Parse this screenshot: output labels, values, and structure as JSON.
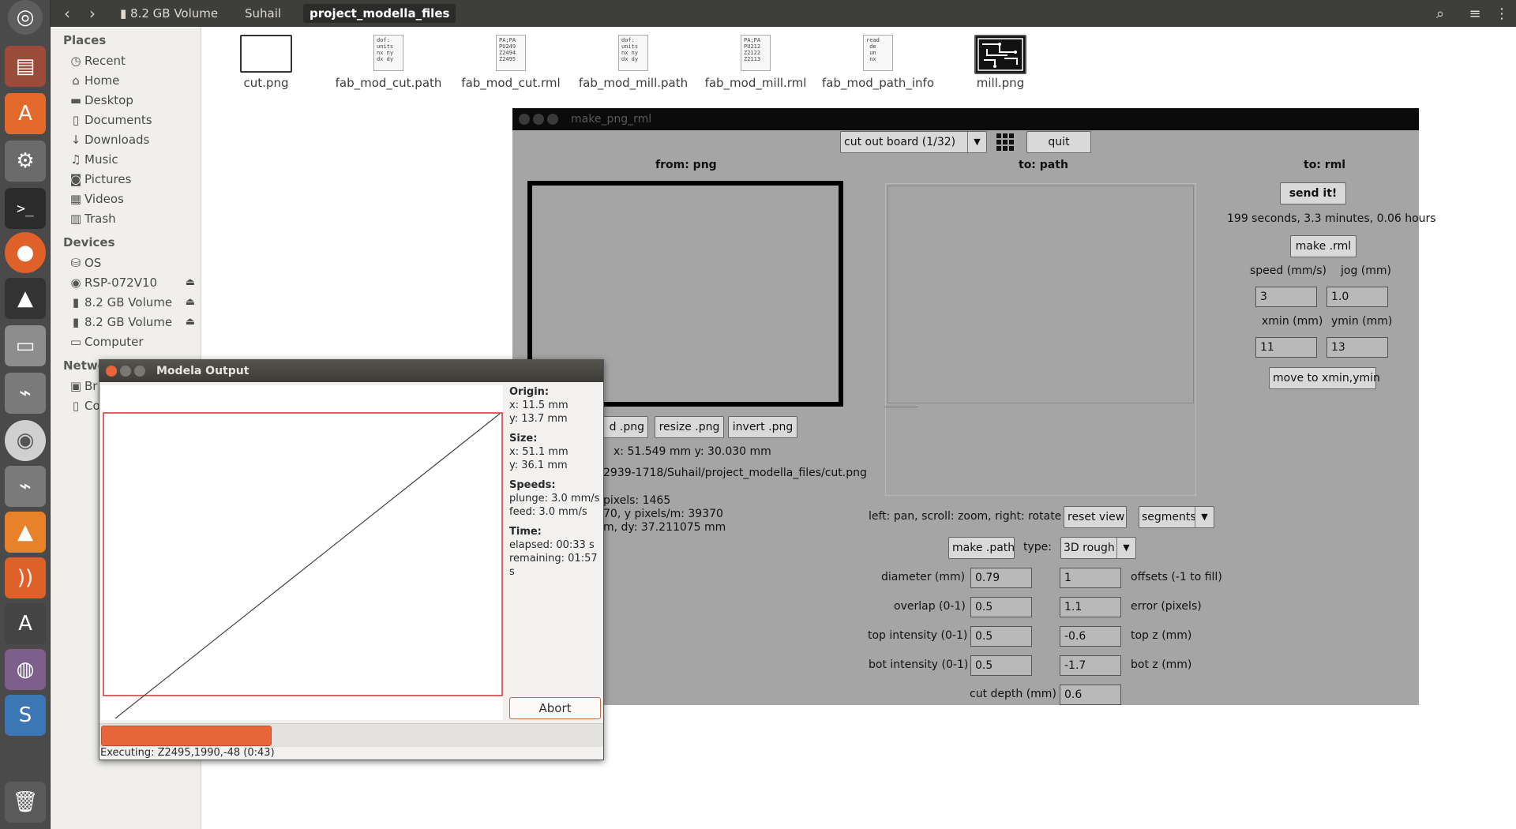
{
  "topbar": {
    "breadcrumbs": [
      "8.2 GB Volume",
      "Suhail",
      "project_modella_files"
    ]
  },
  "sidebar": {
    "places_title": "Places",
    "places": [
      {
        "label": "Recent",
        "icon": "clock-icon"
      },
      {
        "label": "Home",
        "icon": "home-icon"
      },
      {
        "label": "Desktop",
        "icon": "folder-icon"
      },
      {
        "label": "Documents",
        "icon": "document-icon"
      },
      {
        "label": "Downloads",
        "icon": "download-icon"
      },
      {
        "label": "Music",
        "icon": "music-icon"
      },
      {
        "label": "Pictures",
        "icon": "camera-icon"
      },
      {
        "label": "Videos",
        "icon": "video-icon"
      },
      {
        "label": "Trash",
        "icon": "trash-icon"
      }
    ],
    "devices_title": "Devices",
    "devices": [
      {
        "label": "OS",
        "icon": "drive-icon"
      },
      {
        "label": "RSP-072V10",
        "icon": "disc-icon"
      },
      {
        "label": "8.2 GB Volume",
        "icon": "usb-icon"
      },
      {
        "label": "8.2 GB Volume",
        "icon": "usb-icon"
      },
      {
        "label": "Computer",
        "icon": "computer-icon"
      }
    ],
    "network_title": "Netwo",
    "network": [
      {
        "label": "Br",
        "icon": "network-icon"
      },
      {
        "label": "Co",
        "icon": "server-icon"
      }
    ]
  },
  "files": [
    {
      "name": "cut.png",
      "thumb_text": ""
    },
    {
      "name": "fab_mod_cut.path",
      "thumb_text": "dof:\nunits\nnx ny\ndx dy"
    },
    {
      "name": "fab_mod_cut.rml",
      "thumb_text": "PA;PA\nPU249\nZ2494\nZ2495"
    },
    {
      "name": "fab_mod_mill.path",
      "thumb_text": "dof:\nunits\nnx ny\ndx dy"
    },
    {
      "name": "fab_mod_mill.rml",
      "thumb_text": "PA;PA\nPU212\nZ2122\nZ2113"
    },
    {
      "name": "fab_mod_path_info",
      "thumb_text": "read\n de\n un\n nx"
    },
    {
      "name": "mill.png",
      "thumb_text": ""
    }
  ],
  "mpr": {
    "title": "make_png_rml",
    "mode_select": "cut out board (1/32)",
    "quit": "quit",
    "from_header": "from: png",
    "to_path_header": "to: path",
    "to_rml_header": "to: rml",
    "send": "send it!",
    "time_estimate": "199 seconds, 3.3 minutes, 0.06 hours",
    "make_rml": "make .rml",
    "speed_label": "speed (mm/s)",
    "jog_label": "jog (mm)",
    "speed_value": "3",
    "jog_value": "1.0",
    "xmin_label": "xmin (mm)",
    "ymin_label": "ymin (mm)",
    "xmin_value": "11",
    "ymin_value": "13",
    "move_btn": "move to xmin,ymin",
    "load_png": "d .png",
    "resize_png": "resize .png",
    "invert_png": "invert .png",
    "xy_readout": "x: 51.549 mm  y: 30.030 mm",
    "file_path": "2939-1718/Suhail/project_modella_files/cut.png",
    "pixels_line": "pixels: 1465",
    "ppm_line": "70, y pixels/m: 39370",
    "dy_line": "m, dy: 37.211075 mm",
    "view_hint": "left: pan, scroll: zoom, right: rotate",
    "reset_view": "reset view",
    "segments": "segments",
    "make_path": "make .path",
    "type_label": "type:",
    "type_value": "3D rough",
    "diameter_label": "diameter (mm)",
    "diameter_value": "0.79",
    "offsets_value": "1",
    "offsets_label": "offsets (-1 to fill)",
    "overlap_label": "overlap (0-1)",
    "overlap_value": "0.5",
    "error_value": "1.1",
    "error_label": "error (pixels)",
    "top_int_label": "top intensity (0-1)",
    "top_int_value": "0.5",
    "top_z_value": "-0.6",
    "top_z_label": "top z (mm)",
    "bot_int_label": "bot intensity (0-1)",
    "bot_int_value": "0.5",
    "bot_z_value": "-1.7",
    "bot_z_label": "bot z (mm)",
    "cut_depth_label": "cut depth (mm)",
    "cut_depth_value": "0.6"
  },
  "modela": {
    "title": "Modela Output",
    "origin_title": "Origin:",
    "origin_x": "x: 11.5 mm",
    "origin_y": "y: 13.7 mm",
    "size_title": "Size:",
    "size_x": "x: 51.1 mm",
    "size_y": "y: 36.1 mm",
    "speeds_title": "Speeds:",
    "plunge": "plunge: 3.0 mm/s",
    "feed": "feed: 3.0 mm/s",
    "time_title": "Time:",
    "elapsed": "elapsed: 00:33 s",
    "remaining": "remaining: 01:57 s",
    "abort": "Abort",
    "progress_fraction": 0.34,
    "status": "Executing: Z2495,1990,-48 (0:43)"
  },
  "colors": {
    "accent": "#e8643a",
    "toolpath_rect": "#d32f2f"
  }
}
